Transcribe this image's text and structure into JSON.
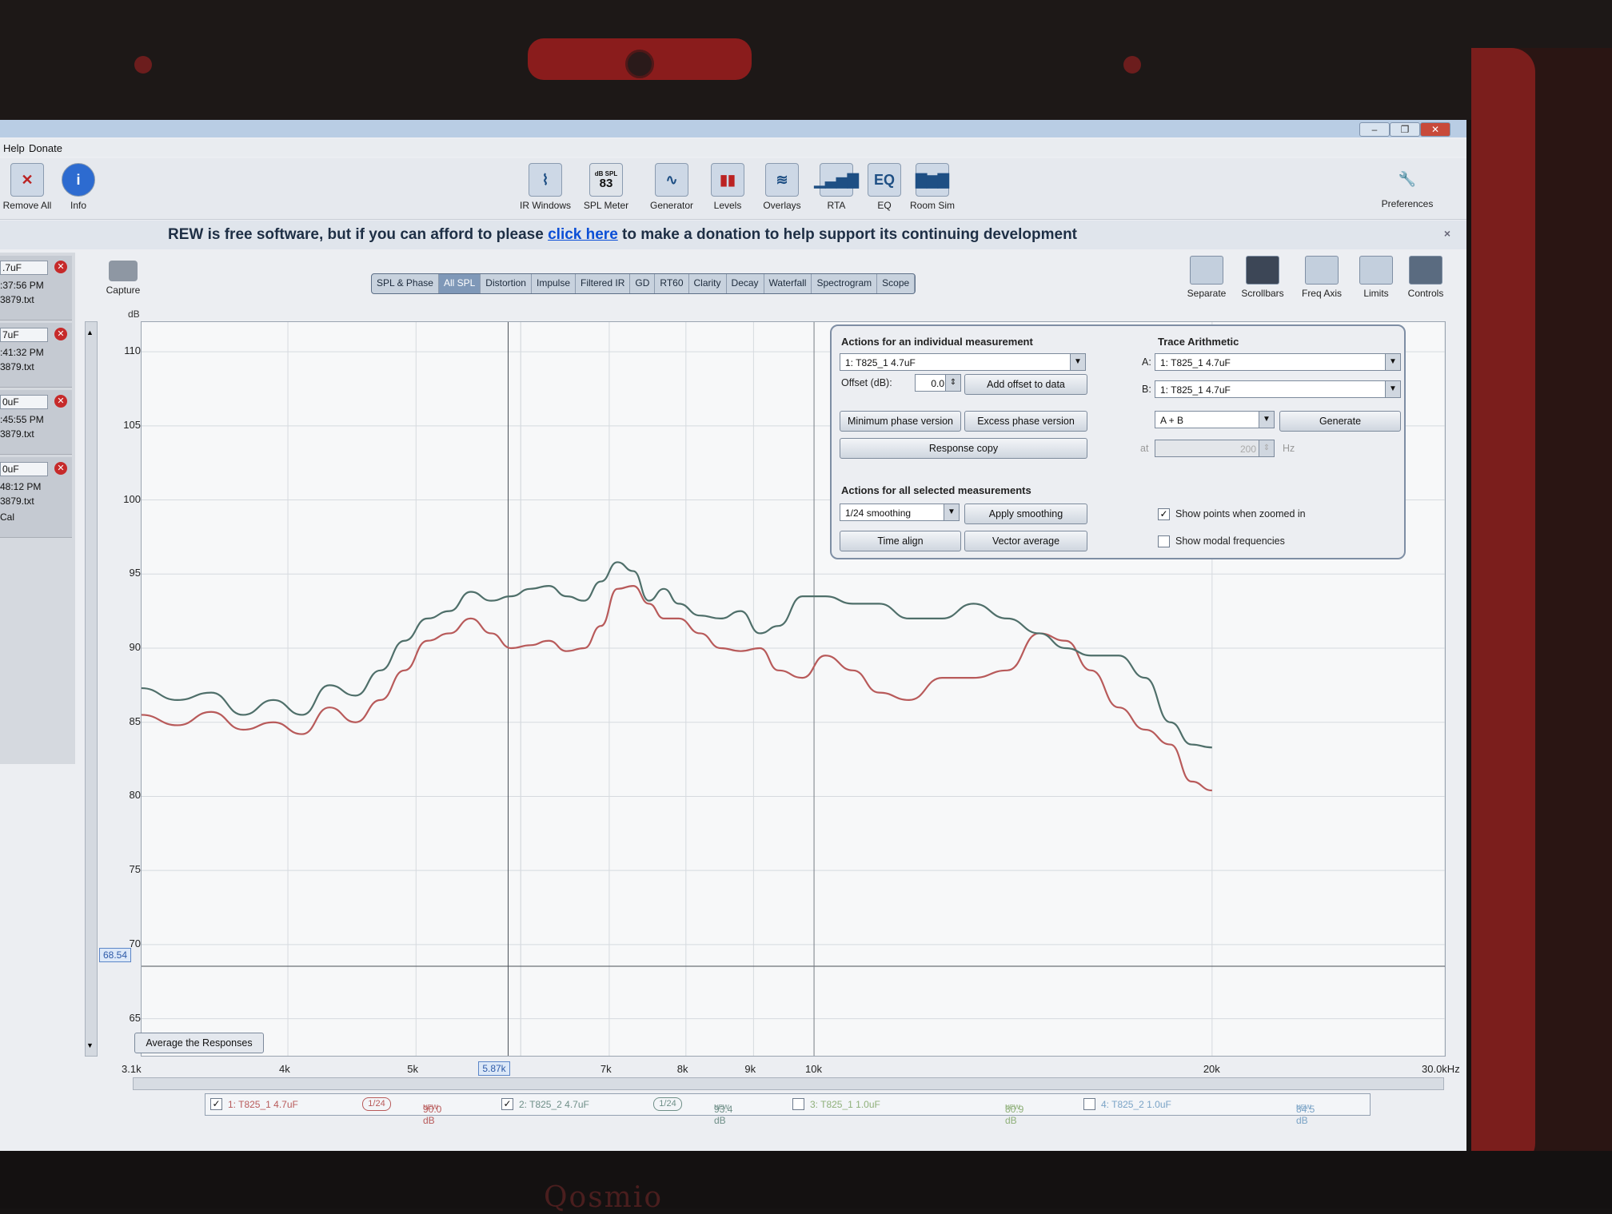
{
  "menu": {
    "help": "Help",
    "donate": "Donate"
  },
  "toolbar": {
    "remove_all": "Remove All",
    "info": "Info",
    "ir_windows": "IR Windows",
    "spl_meter": "SPL Meter",
    "spl_meter_icon_top": "dB SPL",
    "spl_meter_icon_value": "83",
    "generator": "Generator",
    "levels": "Levels",
    "overlays": "Overlays",
    "rta": "RTA",
    "eq": "EQ",
    "room_sim": "Room Sim",
    "preferences": "Preferences"
  },
  "banner": {
    "before": "REW is free software, but if you can afford to please ",
    "link": "click here",
    "after": " to make a donation to help support its continuing development",
    "close": "×"
  },
  "measurements": [
    {
      "name": ".7uF",
      "time": ":37:56 PM",
      "file": "3879.txt"
    },
    {
      "name": "7uF",
      "time": ":41:32 PM",
      "file": "3879.txt"
    },
    {
      "name": "0uF",
      "time": ":45:55 PM",
      "file": "3879.txt"
    },
    {
      "name": "0uF",
      "time": "48:12 PM",
      "file": "3879.txt",
      "cal": "Cal"
    }
  ],
  "capture": "Capture",
  "tabs": [
    "SPL & Phase",
    "All SPL",
    "Distortion",
    "Impulse",
    "Filtered IR",
    "GD",
    "RT60",
    "Clarity",
    "Decay",
    "Waterfall",
    "Spectrogram",
    "Scope"
  ],
  "active_tab": "All SPL",
  "graph_controls": {
    "separate": "Separate",
    "scrollbars": "Scrollbars",
    "freq_axis": "Freq  Axis",
    "limits": "Limits",
    "controls": "Controls"
  },
  "y_unit": "dB",
  "y_cursor": "68.54",
  "x_cursor": "5.87k",
  "average_button": "Average the Responses",
  "actions_panel": {
    "individual_title": "Actions for an individual measurement",
    "measurement_select": "1: T825_1 4.7uF",
    "offset_label": "Offset (dB):",
    "offset_value": "0.0",
    "add_offset": "Add offset to data",
    "min_phase": "Minimum phase version",
    "excess_phase": "Excess phase version",
    "response_copy": "Response copy",
    "all_title": "Actions for all selected measurements",
    "smoothing_select": "1/24 smoothing",
    "apply_smoothing": "Apply smoothing",
    "time_align": "Time align",
    "vector_average": "Vector average",
    "trace_title": "Trace Arithmetic",
    "a_label": "A:",
    "a_select": "1: T825_1 4.7uF",
    "b_label": "B:",
    "b_select": "1: T825_1 4.7uF",
    "op_select": "A + B",
    "generate": "Generate",
    "at_label": "at",
    "at_value": "200",
    "hz_label": "Hz",
    "show_points": "Show points when zoomed in",
    "show_modal": "Show modal frequencies"
  },
  "legend": [
    {
      "checked": true,
      "name": "1: T825_1 4.7uF",
      "smoothing": "1/24",
      "level": "90.0 dB",
      "tag": "NEW",
      "color": "#b85a5a"
    },
    {
      "checked": true,
      "name": "2: T825_2 4.7uF",
      "smoothing": "1/24",
      "level": "93.4 dB",
      "tag": "NEW",
      "color": "#6f8f88"
    },
    {
      "checked": false,
      "name": "3: T825_1 1.0uF",
      "smoothing": "",
      "level": "80.9 dB",
      "tag": "NEW",
      "color": "#8fb07a"
    },
    {
      "checked": false,
      "name": "4: T825_2 1.0uF",
      "smoothing": "",
      "level": "84.5 dB",
      "tag": "NEW",
      "color": "#7aa3c6"
    }
  ],
  "brand": "Qosmio",
  "chart_data": {
    "type": "line",
    "xlabel": "",
    "ylabel": "dB",
    "x_scale": "log",
    "xlim": [
      3100,
      30000
    ],
    "ylim": [
      62.5,
      112
    ],
    "x_ticks": [
      {
        "v": 3100,
        "label": "3.1k"
      },
      {
        "v": 4000,
        "label": "4k"
      },
      {
        "v": 5000,
        "label": "5k"
      },
      {
        "v": 7000,
        "label": "7k"
      },
      {
        "v": 8000,
        "label": "8k"
      },
      {
        "v": 9000,
        "label": "9k"
      },
      {
        "v": 10000,
        "label": "10k"
      },
      {
        "v": 20000,
        "label": "20k"
      },
      {
        "v": 30000,
        "label": "30.0kHz"
      }
    ],
    "y_ticks": [
      65,
      70,
      75,
      80,
      85,
      90,
      95,
      100,
      105,
      110
    ],
    "grid": true,
    "series": [
      {
        "name": "1: T825_1 4.7uF",
        "color": "#b85a5a",
        "x": [
          3100,
          3300,
          3500,
          3700,
          3900,
          4100,
          4300,
          4500,
          4700,
          4900,
          5100,
          5300,
          5500,
          5700,
          5900,
          6100,
          6300,
          6500,
          6700,
          6900,
          7100,
          7300,
          7500,
          7700,
          7900,
          8200,
          8500,
          8800,
          9100,
          9400,
          9800,
          10200,
          10700,
          11200,
          11800,
          12500,
          13200,
          14000,
          14800,
          15500,
          16200,
          17000,
          17800,
          18600,
          19300,
          20000
        ],
        "y": [
          85.5,
          84.8,
          85.7,
          84.5,
          85.0,
          84.2,
          86.0,
          85.0,
          86.5,
          88.5,
          90.5,
          91.0,
          92.0,
          91.0,
          90.0,
          90.2,
          90.5,
          89.8,
          90.0,
          91.5,
          94.0,
          94.2,
          93.0,
          92.0,
          92.0,
          91.0,
          90.0,
          89.8,
          90.0,
          88.5,
          88.0,
          89.5,
          88.5,
          87.0,
          86.5,
          88.0,
          88.0,
          88.5,
          91.0,
          90.5,
          88.5,
          86.0,
          84.5,
          83.5,
          81.0,
          80.4
        ]
      },
      {
        "name": "2: T825_2 4.7uF",
        "color": "#4f6f6a",
        "x": [
          3100,
          3300,
          3500,
          3700,
          3900,
          4100,
          4300,
          4500,
          4700,
          4900,
          5100,
          5300,
          5500,
          5700,
          5900,
          6100,
          6300,
          6500,
          6700,
          6900,
          7100,
          7300,
          7500,
          7700,
          7900,
          8200,
          8500,
          8800,
          9100,
          9400,
          9800,
          10200,
          10700,
          11200,
          11800,
          12500,
          13200,
          14000,
          14800,
          15500,
          16200,
          17000,
          17800,
          18600,
          19300,
          20000
        ],
        "y": [
          87.3,
          86.5,
          87.0,
          85.5,
          86.5,
          85.5,
          87.5,
          86.8,
          88.5,
          90.5,
          92.0,
          92.5,
          93.8,
          93.2,
          93.5,
          94.0,
          94.2,
          93.5,
          93.2,
          94.5,
          95.8,
          95.2,
          93.2,
          94.0,
          93.0,
          92.2,
          92.0,
          92.5,
          91.0,
          91.5,
          93.5,
          93.5,
          93.0,
          93.0,
          92.0,
          92.0,
          93.0,
          92.0,
          91.0,
          90.0,
          89.5,
          89.5,
          88.0,
          85.0,
          83.5,
          83.3
        ]
      }
    ]
  }
}
